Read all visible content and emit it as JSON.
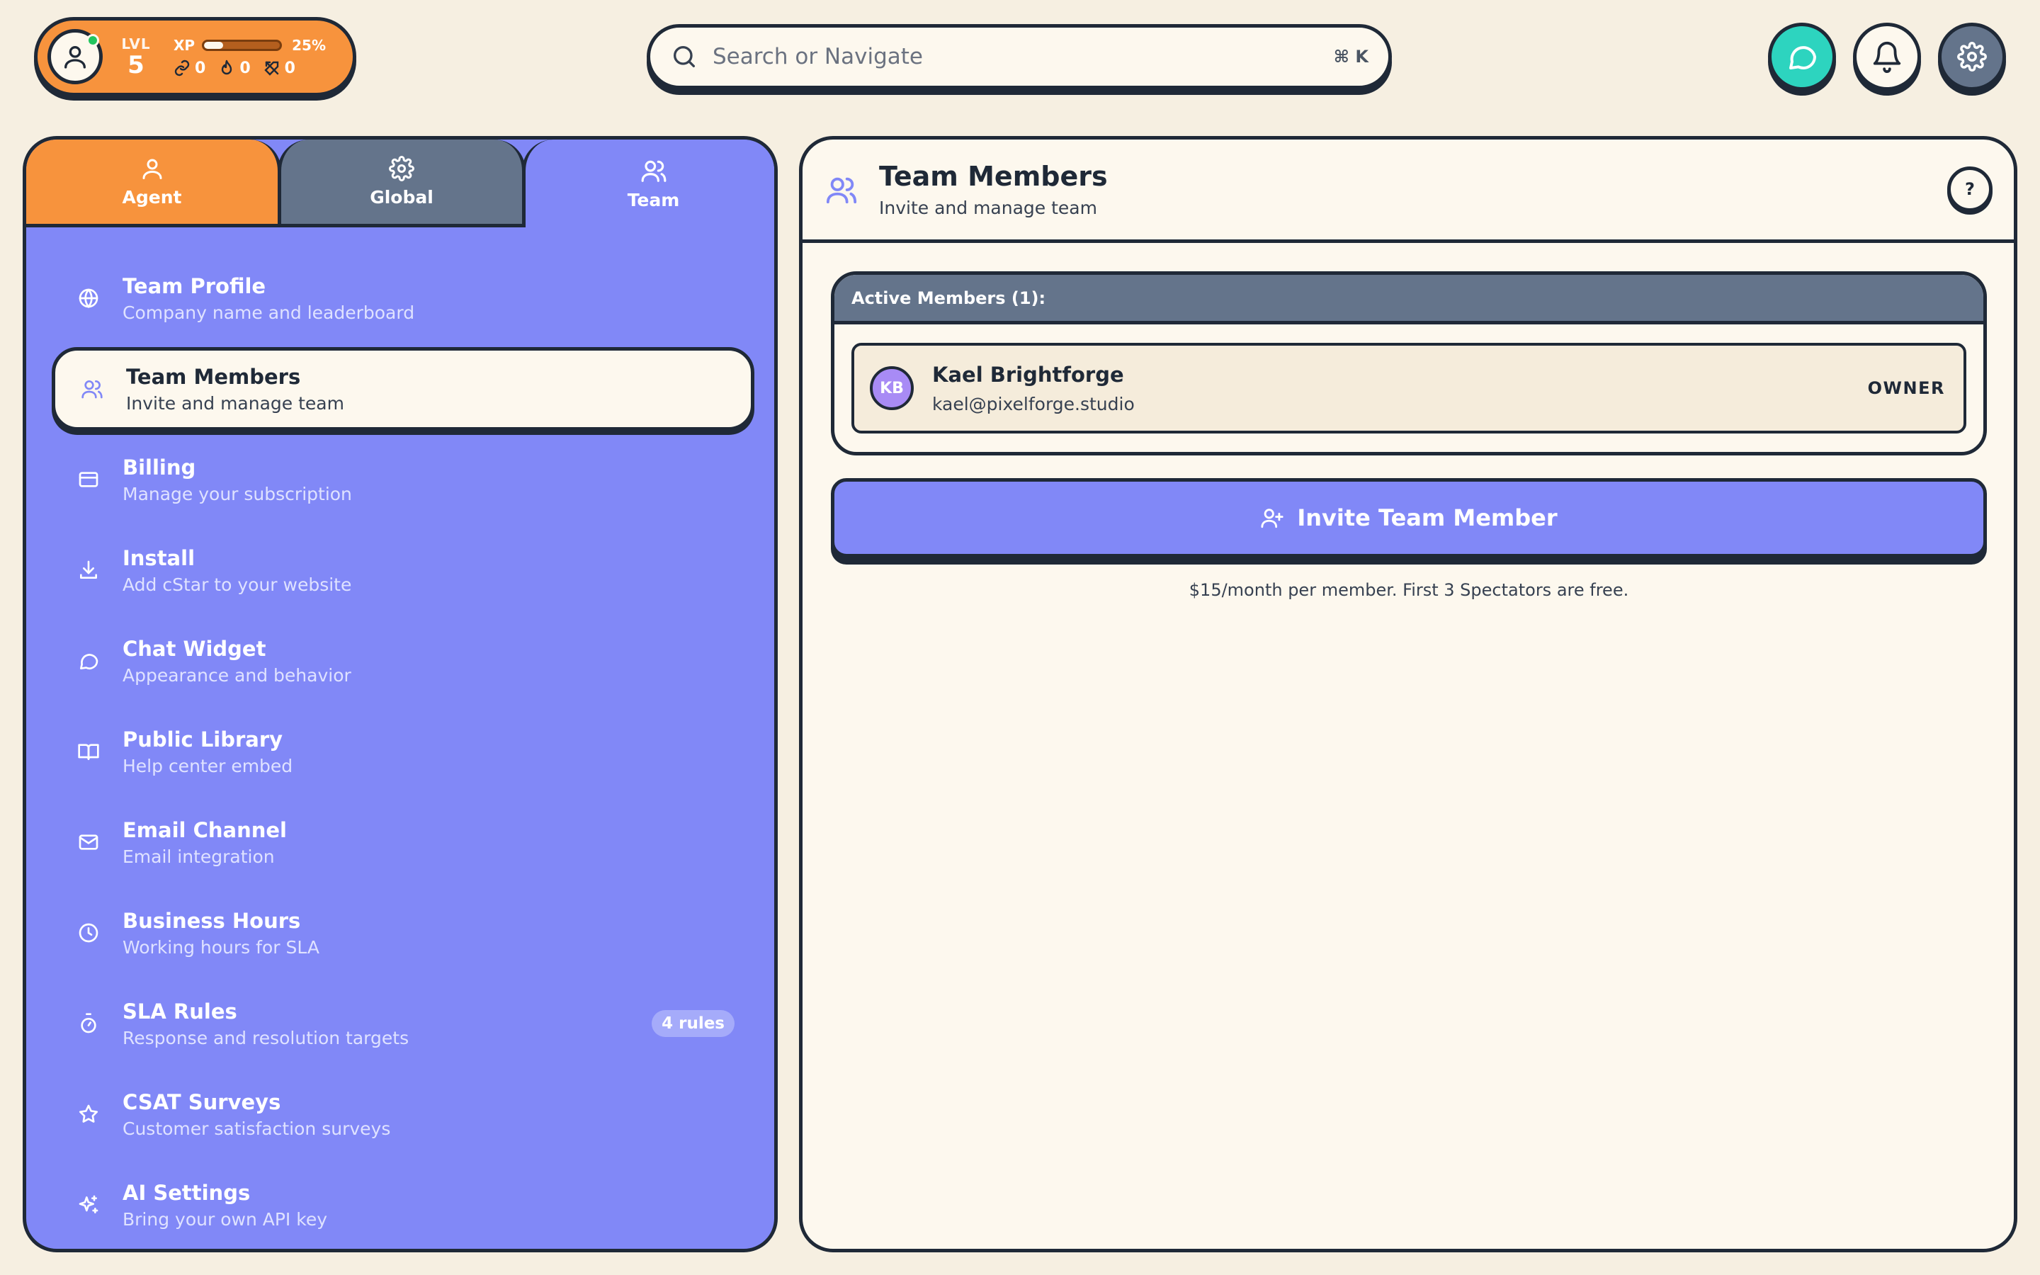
{
  "player": {
    "level_label": "LVL",
    "level": "5",
    "xp_label": "XP",
    "xp_percent_text": "25%",
    "xp_progress": 0.25,
    "stats": [
      {
        "icon": "link-icon",
        "value": "0"
      },
      {
        "icon": "flame-icon",
        "value": "0"
      },
      {
        "icon": "swords-icon",
        "value": "0"
      }
    ]
  },
  "search": {
    "placeholder": "Search or Navigate",
    "shortcut": "⌘ K"
  },
  "top_actions": [
    {
      "name": "chat-button",
      "icon": "chat-bubble-icon",
      "color": "#2dd4bf"
    },
    {
      "name": "notifications-button",
      "icon": "bell-icon",
      "color": "#fdf8ee"
    },
    {
      "name": "settings-button",
      "icon": "gear-icon",
      "color": "#64748b"
    }
  ],
  "tabs": [
    {
      "label": "Agent",
      "icon": "user-icon",
      "color": "#f7933d"
    },
    {
      "label": "Global",
      "icon": "gear-icon",
      "color": "#64748b"
    },
    {
      "label": "Team",
      "icon": "users-icon",
      "color": "#8188f7",
      "active": true
    }
  ],
  "nav": {
    "items": [
      {
        "title": "Team Profile",
        "subtitle": "Company name and leaderboard",
        "icon": "globe-icon"
      },
      {
        "title": "Team Members",
        "subtitle": "Invite and manage team",
        "icon": "users-icon",
        "active": true
      },
      {
        "title": "Billing",
        "subtitle": "Manage your subscription",
        "icon": "credit-card-icon"
      },
      {
        "title": "Install",
        "subtitle": "Add cStar to your website",
        "icon": "download-icon"
      },
      {
        "title": "Chat Widget",
        "subtitle": "Appearance and behavior",
        "icon": "chat-bubble-icon"
      },
      {
        "title": "Public Library",
        "subtitle": "Help center embed",
        "icon": "book-icon"
      },
      {
        "title": "Email Channel",
        "subtitle": "Email integration",
        "icon": "mail-icon"
      },
      {
        "title": "Business Hours",
        "subtitle": "Working hours for SLA",
        "icon": "clock-icon"
      },
      {
        "title": "SLA Rules",
        "subtitle": "Response and resolution targets",
        "icon": "timer-icon",
        "badge": "4 rules"
      },
      {
        "title": "CSAT Surveys",
        "subtitle": "Customer satisfaction surveys",
        "icon": "star-icon"
      },
      {
        "title": "AI Settings",
        "subtitle": "Bring your own API key",
        "icon": "sparkles-icon"
      }
    ]
  },
  "main": {
    "title": "Team Members",
    "subtitle": "Invite and manage team",
    "help_label": "?",
    "members_header": "Active Members (1):",
    "members": [
      {
        "initials": "KB",
        "name": "Kael Brightforge",
        "email": "kael@pixelforge.studio",
        "role": "OWNER"
      }
    ],
    "invite_label": "Invite Team Member",
    "pricing_note": "$15/month per member. First 3 Spectators are free."
  },
  "colors": {
    "background": "#f6efe1",
    "card": "#fdf8ee",
    "accent_purple": "#8188f7",
    "accent_orange": "#f7933d",
    "slate": "#64748b",
    "teal": "#2dd4bf",
    "ink": "#1f2937"
  }
}
